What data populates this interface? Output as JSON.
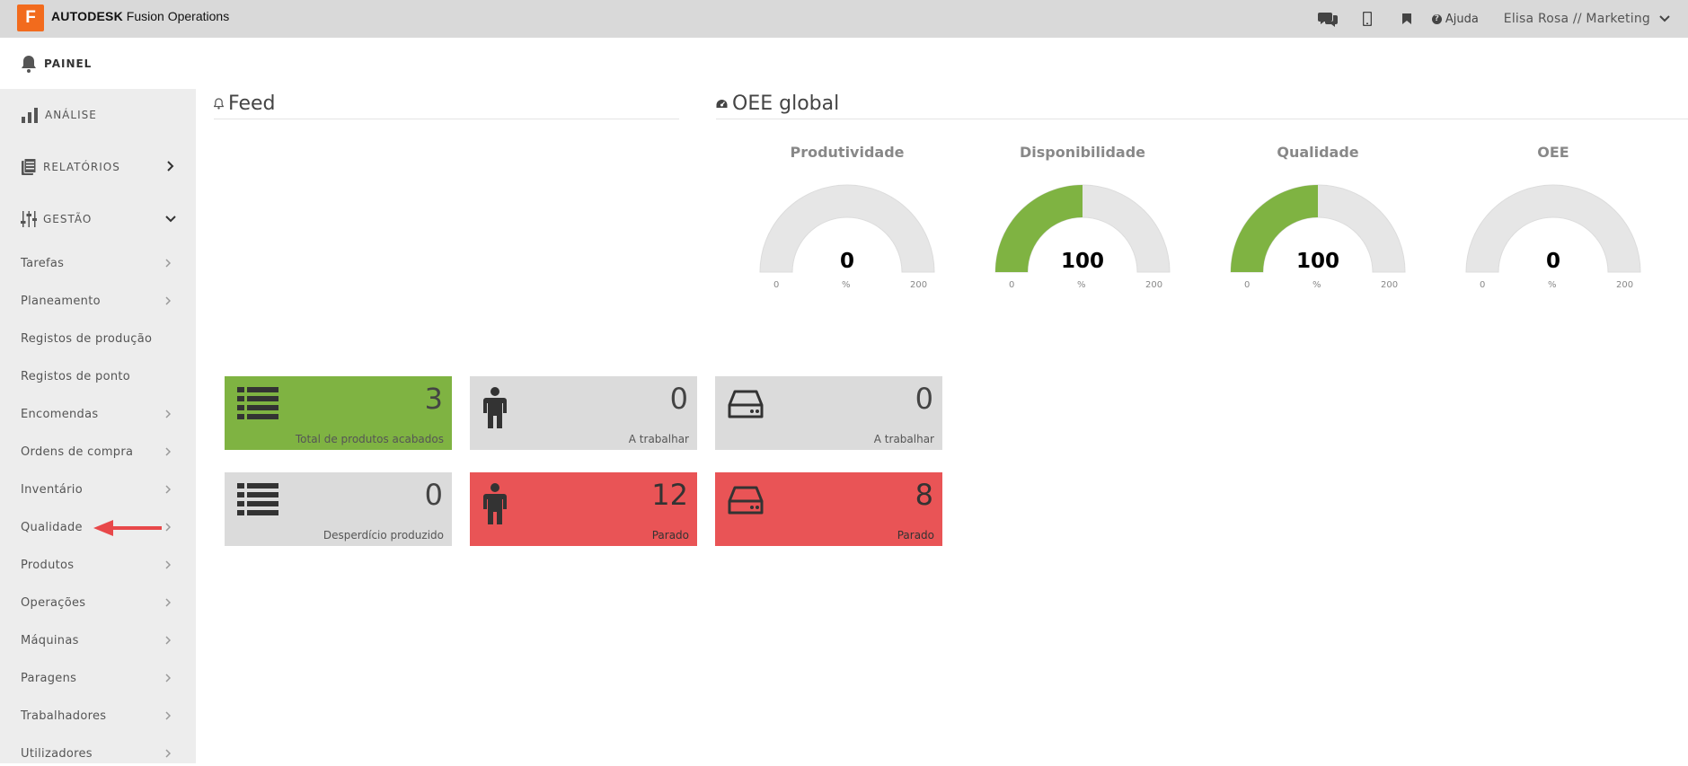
{
  "header": {
    "logo_letter": "F",
    "brand_bold": "AUTODESK",
    "brand_rest": "Fusion Operations",
    "help_label": "Ajuda",
    "user_label": "Elisa Rosa // Marketing"
  },
  "painel": {
    "label": "PAINEL"
  },
  "sidebar": {
    "sections": [
      {
        "label": "ANÁLISE"
      },
      {
        "label": "RELATÓRIOS"
      },
      {
        "label": "GESTÃO"
      }
    ],
    "items": [
      {
        "label": "Tarefas"
      },
      {
        "label": "Planeamento"
      },
      {
        "label": "Registos de produção"
      },
      {
        "label": "Registos de ponto"
      },
      {
        "label": "Encomendas"
      },
      {
        "label": "Ordens de compra"
      },
      {
        "label": "Inventário"
      },
      {
        "label": "Qualidade"
      },
      {
        "label": "Produtos"
      },
      {
        "label": "Operações"
      },
      {
        "label": "Máquinas"
      },
      {
        "label": "Paragens"
      },
      {
        "label": "Trabalhadores"
      },
      {
        "label": "Utilizadores"
      }
    ]
  },
  "feed": {
    "title": "Feed"
  },
  "oee": {
    "title": "OEE global",
    "gauges": [
      {
        "title": "Produtividade",
        "value": "0",
        "min": "0",
        "max": "200",
        "unit": "%",
        "fill": 0
      },
      {
        "title": "Disponibilidade",
        "value": "100",
        "min": "0",
        "max": "200",
        "unit": "%",
        "fill": 0.5
      },
      {
        "title": "Qualidade",
        "value": "100",
        "min": "0",
        "max": "200",
        "unit": "%",
        "fill": 0.5
      },
      {
        "title": "OEE",
        "value": "0",
        "min": "0",
        "max": "200",
        "unit": "%",
        "fill": 0
      }
    ]
  },
  "tiles": [
    {
      "value": "3",
      "label": "Total de produtos acabados",
      "icon": "list-icon",
      "color": "green"
    },
    {
      "value": "0",
      "label": "A trabalhar",
      "icon": "worker-icon",
      "color": "grey"
    },
    {
      "value": "0",
      "label": "A trabalhar",
      "icon": "machine-icon",
      "color": "grey"
    },
    {
      "value": "0",
      "label": "Desperdício produzido",
      "icon": "list-icon",
      "color": "grey"
    },
    {
      "value": "12",
      "label": "Parado",
      "icon": "worker-icon",
      "color": "red"
    },
    {
      "value": "8",
      "label": "Parado",
      "icon": "machine-icon",
      "color": "red"
    }
  ],
  "colors": {
    "accent_green": "#7fb342",
    "alert_red": "#e95456",
    "brand_orange": "#f26b1d"
  }
}
